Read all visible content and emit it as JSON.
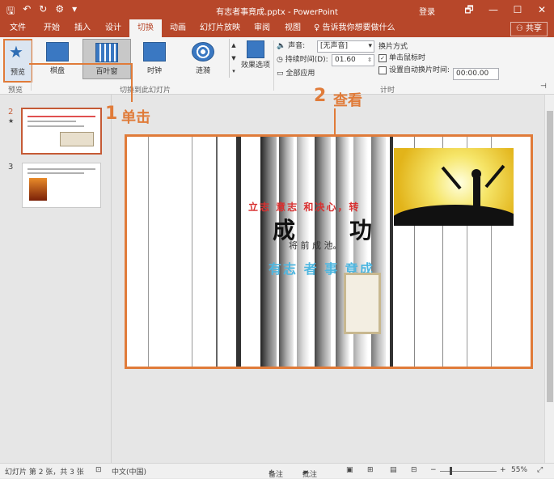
{
  "window": {
    "title": "有志者事竟成.pptx - PowerPoint",
    "login": "登录",
    "controls": [
      "🗗",
      "—",
      "☐",
      "✕"
    ]
  },
  "tabs": {
    "file": "文件",
    "items": [
      "开始",
      "插入",
      "设计",
      "切换",
      "动画",
      "幻灯片放映",
      "审阅",
      "视图"
    ],
    "active": "切换",
    "tellme": "告诉我你想要做什么",
    "share": "共享"
  },
  "ribbon": {
    "preview_label": "预览",
    "preview_group": "预览",
    "transitions": [
      {
        "label": "棋盘",
        "selected": false
      },
      {
        "label": "百叶窗",
        "selected": true
      },
      {
        "label": "时钟",
        "selected": false
      },
      {
        "label": "涟漪",
        "selected": false
      }
    ],
    "effect_options": "效果选项",
    "transition_group": "切换到此幻灯片",
    "sound_label": "声音:",
    "sound_value": "[无声音]",
    "duration_label": "持续时间(D):",
    "duration_value": "01.60",
    "apply_all": "全部应用",
    "advance_title": "换片方式",
    "on_click": "单击鼠标时",
    "after_time": "设置自动换片时间:",
    "after_time_value": "00:00.00",
    "timing_group": "计时"
  },
  "thumbnails": [
    {
      "number": "2",
      "marker": "★",
      "selected": true
    },
    {
      "number": "3",
      "marker": "",
      "selected": false
    }
  ],
  "slide_text": {
    "line1": "立志 意志 和决心，转",
    "big1": "成",
    "big2": "功",
    "quote": "将 前 成 池。",
    "motto": "有志 者 事 竟成"
  },
  "annotations": {
    "step1": "单击",
    "step1_num": "1",
    "step2": "查看",
    "step2_num": "2"
  },
  "status": {
    "slide_info": "幻灯片 第 2 张，共 3 张",
    "language": "中文(中国)",
    "notes": "备注",
    "comments": "批注",
    "zoom": "55%"
  },
  "colors": {
    "accent": "#b7472a",
    "annotation": "#e07b39"
  }
}
